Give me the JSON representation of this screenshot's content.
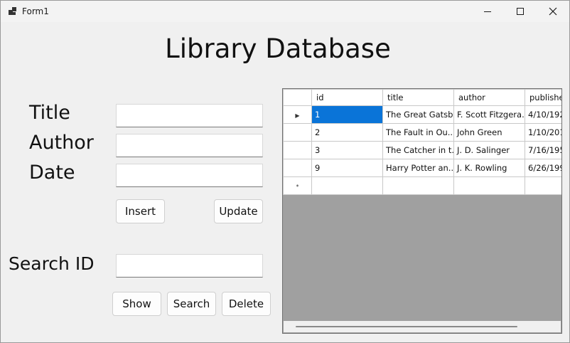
{
  "window": {
    "title": "Form1"
  },
  "heading": "Library Database",
  "form": {
    "title_label": "Title",
    "author_label": "Author",
    "date_label": "Date",
    "search_label": "Search ID",
    "title_value": "",
    "author_value": "",
    "date_value": "",
    "search_value": ""
  },
  "buttons": {
    "insert": "Insert",
    "update": "Update",
    "show": "Show",
    "search": "Search",
    "delete": "Delete"
  },
  "grid": {
    "columns": [
      "id",
      "title",
      "author",
      "publishe"
    ],
    "rows": [
      [
        "1",
        "The Great Gatsby",
        "F. Scott Fitzgera...",
        "4/10/192"
      ],
      [
        "2",
        "The Fault in Ou...",
        "John Green",
        "1/10/201"
      ],
      [
        "3",
        "The Catcher in t...",
        "J. D. Salinger",
        "7/16/195"
      ],
      [
        "9",
        "Harry Potter an...",
        "J. K. Rowling",
        "6/26/199"
      ]
    ],
    "current_row_glyph": "▶",
    "new_row_glyph": "*",
    "selected_cell_color": "#0a74d8"
  }
}
